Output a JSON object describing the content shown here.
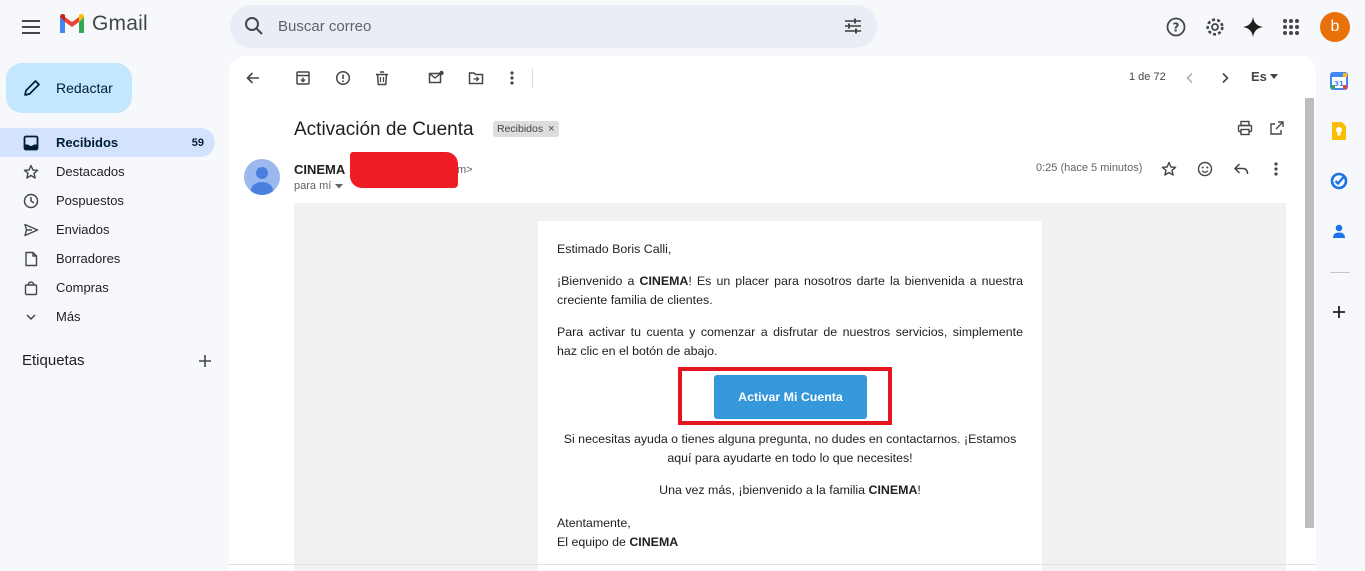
{
  "app": {
    "name": "Gmail"
  },
  "search": {
    "placeholder": "Buscar correo"
  },
  "account": {
    "initial": "b"
  },
  "compose": {
    "label": "Redactar"
  },
  "nav": [
    {
      "label": "Recibidos",
      "count": "59",
      "icon": "inbox-icon",
      "active": true
    },
    {
      "label": "Destacados",
      "icon": "star-icon"
    },
    {
      "label": "Pospuestos",
      "icon": "clock-icon"
    },
    {
      "label": "Enviados",
      "icon": "send-icon"
    },
    {
      "label": "Borradores",
      "icon": "draft-icon"
    },
    {
      "label": "Compras",
      "icon": "shopping-bag-icon"
    },
    {
      "label": "Más",
      "icon": "chevron-down-icon"
    }
  ],
  "labels_section": {
    "title": "Etiquetas"
  },
  "toolbar": {
    "pager": "1 de 72",
    "language": "Es"
  },
  "email": {
    "subject": "Activación de Cuenta",
    "label_chip": "Recibidos",
    "sender_name": "CINEMA",
    "sender_email_tail": "m>",
    "recipient": "para mí",
    "time": "0:25 (hace 5 minutos)",
    "greeting": "Estimado Boris Calli,",
    "para1": "¡Bienvenido a CINEMA! Es un placer para nosotros darte la bienvenida a nuestra creciente familia de clientes.",
    "para2": "Para activar tu cuenta y comenzar a disfrutar de nuestros servicios, simplemente haz clic en el botón de abajo.",
    "cta": "Activar Mi Cuenta",
    "para3": "Si necesitas ayuda o tienes alguna pregunta, no dudes en contactarnos. ¡Estamos aquí para ayudarte en todo lo que necesites!",
    "para4": "Una vez más, ¡bienvenido a la familia CINEMA!",
    "closing": "Atentamente,",
    "signature": "El equipo de CINEMA"
  },
  "colors": {
    "accent": "#3498db",
    "highlight": "#e3161d",
    "avatar": "#e8710a",
    "nav_active": "#d3e3fd",
    "compose": "#c2e7ff"
  }
}
